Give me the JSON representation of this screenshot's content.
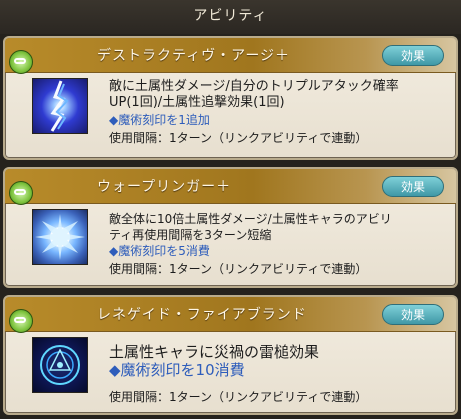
{
  "header": {
    "title": "アビリティ"
  },
  "abilities": [
    {
      "name": "デストラクティヴ・アージ＋",
      "effect_button": "効果",
      "description_line1": "敵に土属性ダメージ/自分のトリプルアタック確率",
      "description_line2": "UP(1回)/土属性追撃効果(1回)",
      "cost": "◆魔術刻印を1追加",
      "cooldown": "使用間隔：1ターン（リンクアビリティで連動）",
      "icon": "blue-lightning-skill-icon"
    },
    {
      "name": "ウォープリンガー＋",
      "effect_button": "効果",
      "description_line1": "敵全体に10倍土属性ダメージ/土属性キャラのアビリ",
      "description_line2": "ティ再使用間隔を3ターン短縮",
      "cost": "◆魔術刻印を5消費",
      "cooldown": "使用間隔：1ターン（リンクアビリティで連動）",
      "icon": "burst-skill-icon"
    },
    {
      "name": "レネゲイド・ファイアブランド",
      "effect_button": "効果",
      "description_line1": "土属性キャラに災禍の雷槌効果",
      "cost": "◆魔術刻印を10消費",
      "cooldown": "使用間隔：1ターン（リンクアビリティで連動）",
      "icon": "magic-circle-skill-icon"
    }
  ]
}
